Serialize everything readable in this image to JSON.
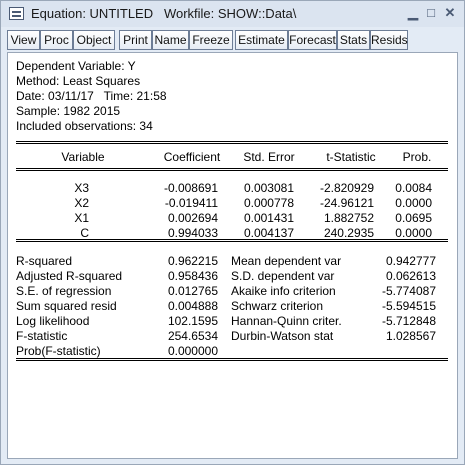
{
  "window": {
    "title": "Equation: UNTITLED   Workfile: SHOW::Data\\",
    "min_glyph": "▁",
    "restore_glyph": "□",
    "close_glyph": "✕"
  },
  "toolbar": [
    "View",
    "Proc",
    "Object",
    "Print",
    "Name",
    "Freeze",
    "Estimate",
    "Forecast",
    "Stats",
    "Resids"
  ],
  "header": {
    "dependent": "Dependent Variable: Y",
    "method": "Method: Least Squares",
    "date": "Date: 03/11/17   Time: 21:58",
    "sample": "Sample: 1982 2015",
    "observations": "Included observations: 34"
  },
  "coef_table": {
    "columns": [
      "Variable",
      "Coefficient",
      "Std. Error",
      "t-Statistic",
      "Prob."
    ],
    "rows": [
      [
        "X3",
        "-0.008691",
        "0.003081",
        "-2.820929",
        "0.0084"
      ],
      [
        "X2",
        "-0.019411",
        "0.000778",
        "-24.96121",
        "0.0000"
      ],
      [
        "X1",
        "0.002694",
        "0.001431",
        "1.882752",
        "0.0695"
      ],
      [
        "C",
        "0.994033",
        "0.004137",
        "240.2935",
        "0.0000"
      ]
    ]
  },
  "stats": {
    "left": [
      [
        "R-squared",
        "0.962215"
      ],
      [
        "Adjusted R-squared",
        "0.958436"
      ],
      [
        "S.E. of regression",
        "0.012765"
      ],
      [
        "Sum squared resid",
        "0.004888"
      ],
      [
        "Log likelihood",
        "102.1595"
      ],
      [
        "F-statistic",
        "254.6534"
      ],
      [
        "Prob(F-statistic)",
        "0.000000"
      ]
    ],
    "right": [
      [
        "Mean dependent var",
        "0.942777"
      ],
      [
        "S.D. dependent var",
        "0.062613"
      ],
      [
        "Akaike info criterion",
        "-5.774087"
      ],
      [
        "Schwarz criterion",
        "-5.594515"
      ],
      [
        "Hannan-Quinn criter.",
        "-5.712848"
      ],
      [
        "Durbin-Watson stat",
        "1.028567"
      ]
    ]
  }
}
